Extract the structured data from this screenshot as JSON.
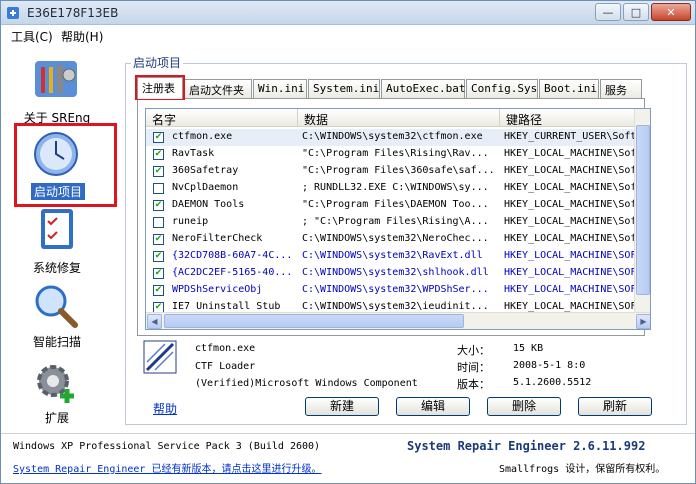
{
  "window": {
    "title": "E36E178F13EB"
  },
  "menu": [
    "工具(C)",
    "帮助(H)"
  ],
  "nav": [
    {
      "label": "关于 SREng",
      "icon": "tools-icon"
    },
    {
      "label": "启动项目",
      "icon": "clock-icon",
      "selected": true
    },
    {
      "label": "系统修复",
      "icon": "checklist-icon"
    },
    {
      "label": "智能扫描",
      "icon": "magnifier-icon"
    },
    {
      "label": "扩展",
      "icon": "gear-plus-icon"
    }
  ],
  "group_title": "启动项目",
  "tabs": [
    "注册表",
    "启动文件夹",
    "Win.ini",
    "System.ini",
    "AutoExec.bat",
    "Config.Sys",
    "Boot.ini",
    "服务"
  ],
  "columns": [
    "名字",
    "数据",
    "键路径"
  ],
  "rows": [
    {
      "checked": true,
      "name": "ctfmon.exe",
      "data": "C:\\WINDOWS\\system32\\ctfmon.exe",
      "path": "HKEY_CURRENT_USER\\Soft",
      "color": "#000000",
      "highlight": true
    },
    {
      "checked": true,
      "name": "RavTask",
      "data": "\"C:\\Program Files\\Rising\\Rav...",
      "path": "HKEY_LOCAL_MACHINE\\Sof",
      "color": "#000000"
    },
    {
      "checked": true,
      "name": "360Safetray",
      "data": "\"C:\\Program Files\\360safe\\saf...",
      "path": "HKEY_LOCAL_MACHINE\\Sof",
      "color": "#000000"
    },
    {
      "checked": false,
      "name": "NvCplDaemon",
      "data": "; RUNDLL32.EXE C:\\WINDOWS\\sy...",
      "path": "HKEY_LOCAL_MACHINE\\Sof",
      "color": "#000000"
    },
    {
      "checked": true,
      "name": "DAEMON Tools",
      "data": "\"C:\\Program Files\\DAEMON Too...",
      "path": "HKEY_LOCAL_MACHINE\\Sof",
      "color": "#000000"
    },
    {
      "checked": false,
      "name": "runeip",
      "data": "; \"C:\\Program Files\\Rising\\A...",
      "path": "HKEY_LOCAL_MACHINE\\Sof",
      "color": "#000000"
    },
    {
      "checked": true,
      "name": "NeroFilterCheck",
      "data": "C:\\WINDOWS\\system32\\NeroChec...",
      "path": "HKEY_LOCAL_MACHINE\\Sof",
      "color": "#000000"
    },
    {
      "checked": true,
      "name": "{32CD708B-60A7-4C...",
      "data": "C:\\WINDOWS\\system32\\RavExt.dll",
      "path": "HKEY_LOCAL_MACHINE\\SOF",
      "color": "#0000c0"
    },
    {
      "checked": true,
      "name": "{AC2DC2EF-5165-40...",
      "data": "C:\\WINDOWS\\system32\\shlhook.dll",
      "path": "HKEY_LOCAL_MACHINE\\SOF",
      "color": "#0000c0"
    },
    {
      "checked": true,
      "name": "WPDShServiceObj",
      "data": "C:\\WINDOWS\\system32\\WPDShSer...",
      "path": "HKEY_LOCAL_MACHINE\\SOF",
      "color": "#0000c0"
    },
    {
      "checked": true,
      "name": "IE7 Uninstall Stub",
      "data": "C:\\WINDOWS\\system32\\ieudinit...",
      "path": "HKEY_LOCAL_MACHINE\\SOF",
      "color": "#000000"
    }
  ],
  "detail": {
    "name": "ctfmon.exe",
    "desc": "CTF Loader",
    "company": "(Verified)Microsoft Windows Component",
    "size_label": "大小：",
    "size": "15 KB",
    "time_label": "时间：",
    "time": "2008-5-1 8:0",
    "version_label": "版本：",
    "version": "5.1.2600.5512"
  },
  "help_link": "帮助",
  "buttons": [
    "新建",
    "编辑",
    "删除",
    "刷新"
  ],
  "status": {
    "os": "Windows XP Professional Service Pack 3 (Build 2600)",
    "update_notice": "System Repair Engineer 已经有新版本，请点击这里进行升级。",
    "brand": "System Repair Engineer 2.6.11.992",
    "copyright": "Smallfrogs 设计，保留所有权利。"
  }
}
